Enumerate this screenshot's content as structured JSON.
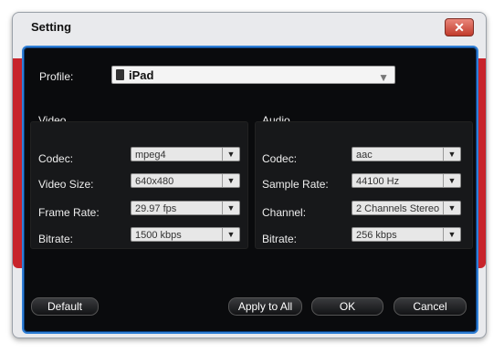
{
  "window": {
    "title": "Setting",
    "close_glyph": "✕"
  },
  "profile": {
    "label": "Profile:",
    "value": "iPad",
    "icon": "ipad-device-icon"
  },
  "video": {
    "heading": "Video",
    "fields": [
      {
        "label": "Codec:",
        "value": "mpeg4"
      },
      {
        "label": "Video Size:",
        "value": "640x480"
      },
      {
        "label": "Frame Rate:",
        "value": "29.97 fps"
      },
      {
        "label": "Bitrate:",
        "value": "1500 kbps"
      }
    ]
  },
  "audio": {
    "heading": "Audio",
    "fields": [
      {
        "label": "Codec:",
        "value": "aac"
      },
      {
        "label": "Sample Rate:",
        "value": "44100 Hz"
      },
      {
        "label": "Channel:",
        "value": "2 Channels Stereo"
      },
      {
        "label": "Bitrate:",
        "value": "256 kbps"
      }
    ]
  },
  "buttons": {
    "default": "Default",
    "apply_all": "Apply to All",
    "ok": "OK",
    "cancel": "Cancel"
  },
  "glyphs": {
    "dropdown": "▼"
  }
}
